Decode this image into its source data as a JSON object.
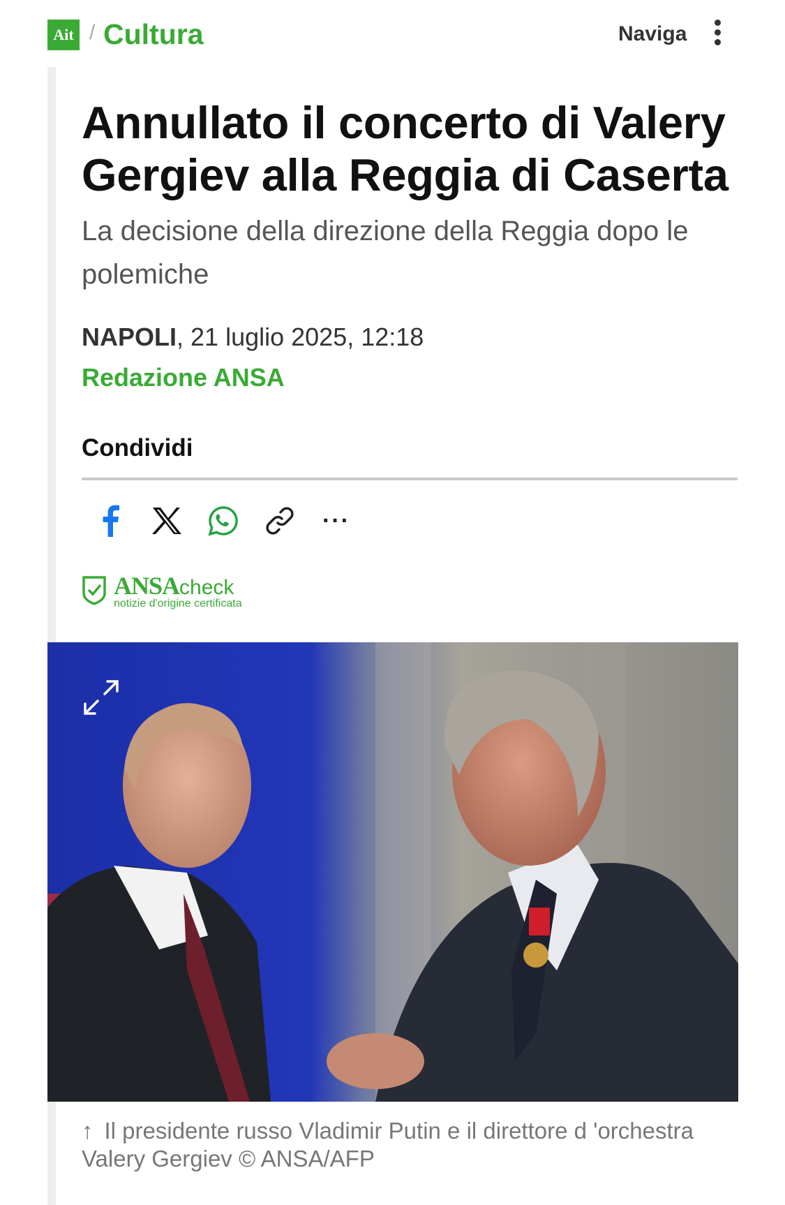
{
  "header": {
    "logo_text": "Ait",
    "breadcrumb_separator": "/",
    "section": "Cultura",
    "nav_label": "Naviga"
  },
  "article": {
    "headline": "Annullato il concerto di Valery Gergiev alla Reggia di Caserta",
    "subheadline": "La decisione della direzione della Reggia dopo le polemiche",
    "dateline_place": "NAPOLI",
    "dateline_date": ", 21 luglio 2025, 12:18",
    "author": "Redazione ANSA"
  },
  "share": {
    "label": "Condividi",
    "icons": [
      "facebook-icon",
      "x-icon",
      "whatsapp-icon",
      "link-icon",
      "more-icon"
    ],
    "more_label": "···"
  },
  "ansacheck": {
    "brand": "ANSA",
    "brand_suffix": "check",
    "tagline": "notizie d'origine certificata"
  },
  "photo": {
    "caption_arrow": "↑",
    "caption": "Il presidente russo Vladimir Putin e il direttore d 'orchestra Valery Gergiev © ANSA/AFP"
  },
  "colors": {
    "brand_green": "#3aaa35",
    "facebook_blue": "#1877f2",
    "whatsapp_green": "#25a244"
  }
}
